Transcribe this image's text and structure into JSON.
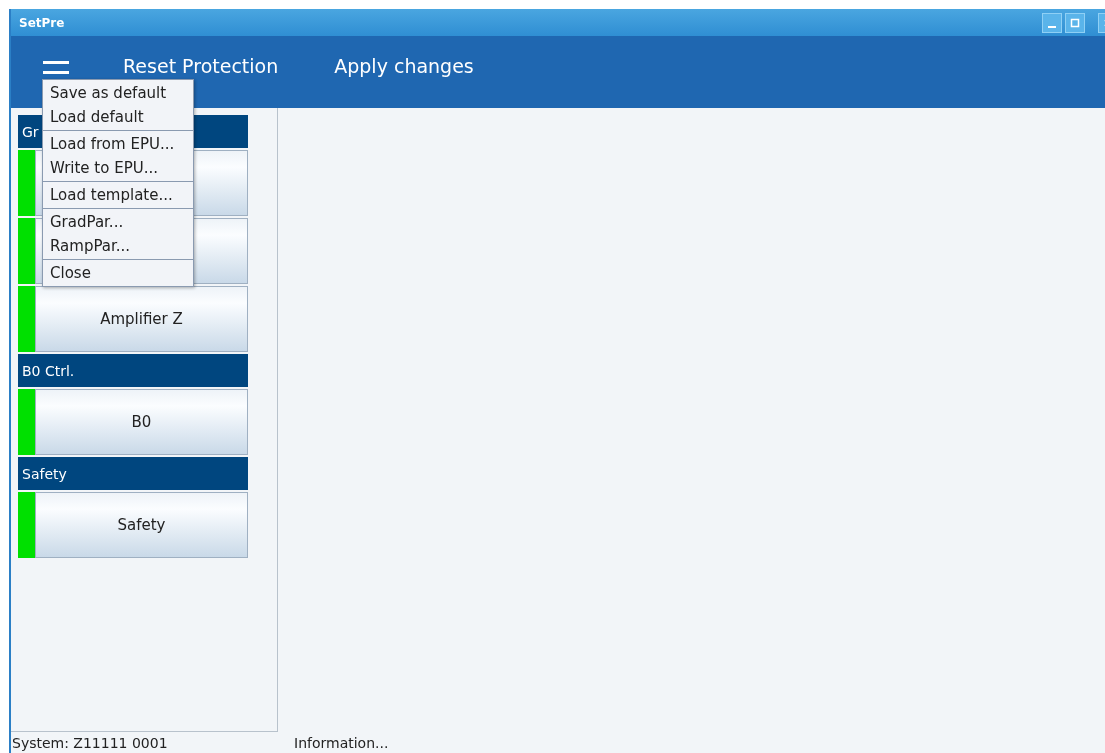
{
  "window": {
    "title": "SetPre"
  },
  "toolbar": {
    "actions": [
      "Reset Protection",
      "Apply changes"
    ]
  },
  "menu": {
    "open": true,
    "sections": [
      {
        "items": [
          "Save as default",
          "Load default"
        ]
      },
      {
        "items": [
          "Load from EPU...",
          "Write to EPU..."
        ]
      },
      {
        "items": [
          "Load template..."
        ]
      },
      {
        "items": [
          "GradPar...",
          "RampPar..."
        ]
      },
      {
        "items": [
          "Close"
        ]
      }
    ]
  },
  "groups": [
    {
      "title": "Gr",
      "buttons": [
        {
          "ok": true
        },
        {
          "ok": true
        },
        {
          "label": "Amplifier Z",
          "ok": true
        }
      ]
    },
    {
      "title": "B0 Ctrl.",
      "buttons": [
        {
          "label": "B0",
          "ok": true
        }
      ]
    },
    {
      "title": "Safety",
      "buttons": [
        {
          "label": "Safety",
          "ok": true
        }
      ]
    }
  ],
  "status_bar": {
    "system": "System: Z11111 0001",
    "info": "Information..."
  }
}
